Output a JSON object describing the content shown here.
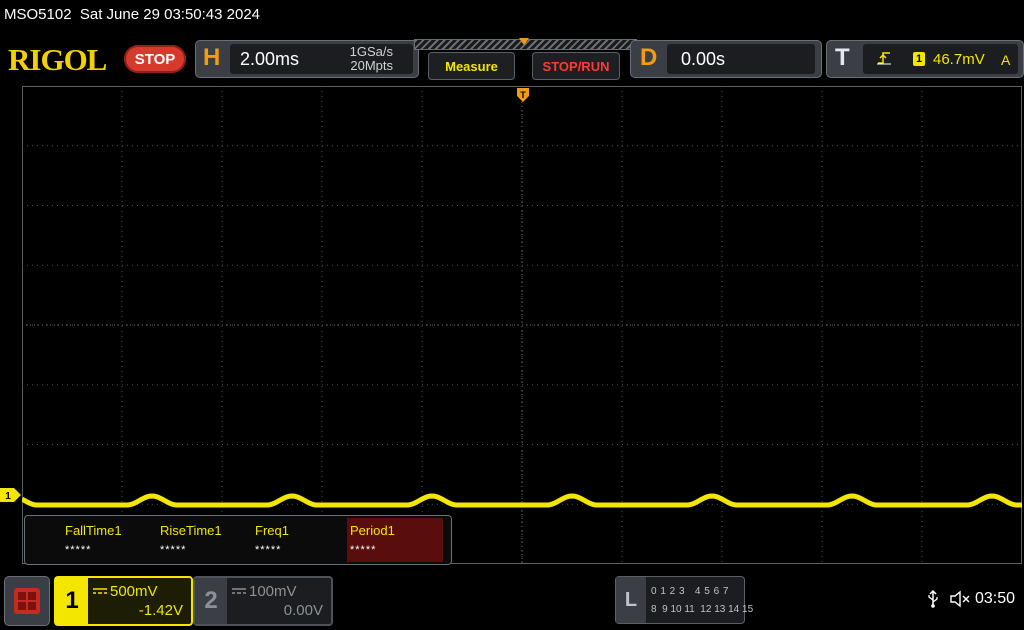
{
  "header": {
    "title_line": "MSO5102  Sat June 29 03:50:43 2024",
    "brand": "RIGOL",
    "status": "STOP"
  },
  "horizontal": {
    "letter": "H",
    "timebase": "2.00ms",
    "sample_rate": "1GSa/s",
    "memory_depth": "20Mpts"
  },
  "menu": {
    "measure_label": "Measure",
    "stoprun_label": "STOP/RUN"
  },
  "delay": {
    "letter": "D",
    "value": "0.00s"
  },
  "trigger": {
    "letter": "T",
    "source_channel": "1",
    "level": "46.7mV",
    "mode": "A",
    "marker_label": "T"
  },
  "measurements": {
    "items": [
      {
        "name": "FallTime1",
        "value": "*****"
      },
      {
        "name": "RiseTime1",
        "value": "*****"
      },
      {
        "name": "Freq1",
        "value": "*****"
      },
      {
        "name": "Period1",
        "value": "*****"
      }
    ]
  },
  "channels": {
    "ch1": {
      "number": "1",
      "scale": "500mV",
      "offset": "-1.42V",
      "marker_label": "1"
    },
    "ch2": {
      "number": "2",
      "scale": "100mV",
      "offset": "0.00V"
    }
  },
  "logic": {
    "letter": "L",
    "row1": "0 1 2 3   4 5 6 7",
    "row2": "8  9 10 11  12 13 14 15"
  },
  "clock": "03:50",
  "colors": {
    "ch1": "#f3e600",
    "accent": "#f39c12",
    "stop": "#d63a2d"
  }
}
